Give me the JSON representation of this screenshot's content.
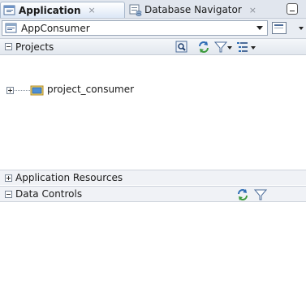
{
  "tabs": [
    {
      "label": "Application",
      "active": true,
      "icon": "application-icon"
    },
    {
      "label": "Database Navigator",
      "active": false,
      "icon": "database-navigator-icon"
    }
  ],
  "application_selector": {
    "value": "AppConsumer",
    "icon": "application-workspace-icon"
  },
  "sections": {
    "projects": {
      "label": "Projects",
      "expanded": true,
      "toolbar_icons": [
        "search-icon",
        "refresh-icon",
        "filter-icon",
        "view-options-icon"
      ]
    },
    "application_resources": {
      "label": "Application Resources",
      "expanded": false
    },
    "data_controls": {
      "label": "Data Controls",
      "expanded": true,
      "toolbar_icons": [
        "refresh-icon",
        "filter-icon"
      ]
    }
  },
  "tree": {
    "items": [
      {
        "label": "project_consumer",
        "icon": "folder-icon",
        "expanded": false
      }
    ]
  },
  "colors": {
    "tab_bar_bg": "#e1e6ee",
    "active_tab_bg": "#dce7f6",
    "section_bg": "#f0f2f6",
    "accent_blue": "#2f6db5",
    "folder_blue": "#4d8fd6"
  }
}
